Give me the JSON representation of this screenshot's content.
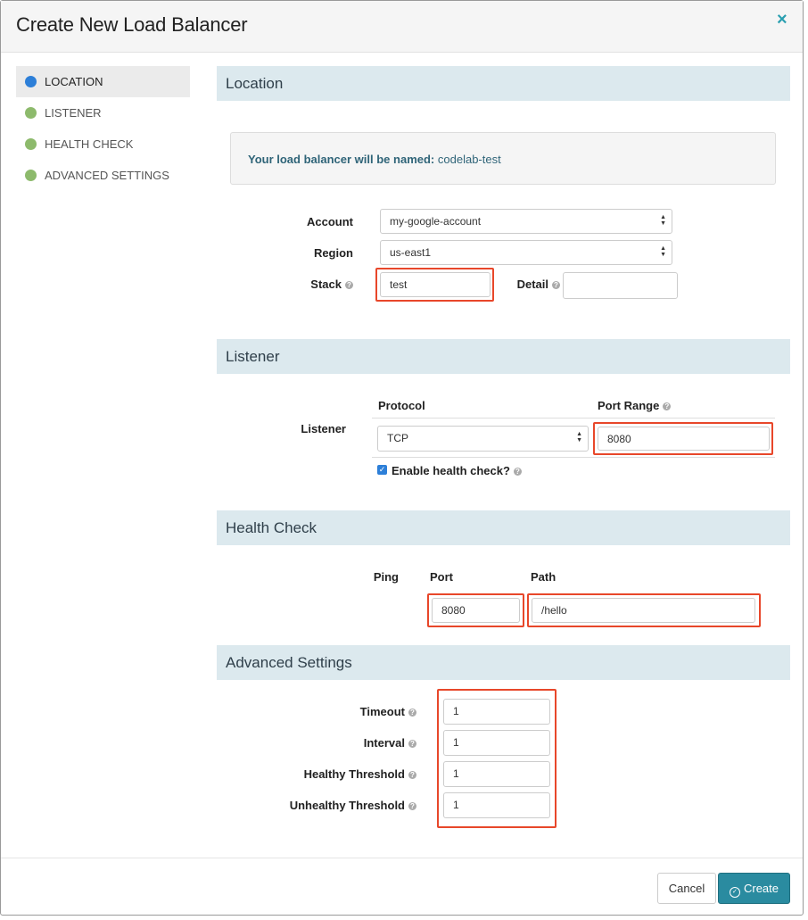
{
  "modal": {
    "title": "Create New Load Balancer",
    "close_icon": "×"
  },
  "nav": {
    "items": [
      {
        "label": "LOCATION",
        "color": "#2d7fd8",
        "active": true
      },
      {
        "label": "LISTENER",
        "color": "#8dba6c",
        "active": false
      },
      {
        "label": "HEALTH CHECK",
        "color": "#8dba6c",
        "active": false
      },
      {
        "label": "ADVANCED SETTINGS",
        "color": "#8dba6c",
        "active": false
      }
    ]
  },
  "location": {
    "title": "Location",
    "name_prefix": "Your load balancer will be named:",
    "name_value": "codelab-test",
    "account_label": "Account",
    "account_value": "my-google-account",
    "region_label": "Region",
    "region_value": "us-east1",
    "stack_label": "Stack",
    "stack_value": "test",
    "detail_label": "Detail",
    "detail_value": ""
  },
  "listener": {
    "title": "Listener",
    "row_label": "Listener",
    "protocol_header": "Protocol",
    "port_range_header": "Port Range",
    "protocol_value": "TCP",
    "port_range_value": "8080",
    "health_check_label": "Enable health check?",
    "health_check_checked": true
  },
  "health_check": {
    "title": "Health Check",
    "ping_label": "Ping",
    "port_header": "Port",
    "path_header": "Path",
    "port_value": "8080",
    "path_value": "/hello"
  },
  "advanced": {
    "title": "Advanced Settings",
    "timeout_label": "Timeout",
    "timeout_value": "1",
    "interval_label": "Interval",
    "interval_value": "1",
    "healthy_label": "Healthy Threshold",
    "healthy_value": "1",
    "unhealthy_label": "Unhealthy Threshold",
    "unhealthy_value": "1"
  },
  "footer": {
    "cancel_label": "Cancel",
    "create_label": "Create",
    "create_icon": "check-circle-icon"
  },
  "colors": {
    "accent": "#2a8ba0",
    "highlight": "#e8472a",
    "section_bg": "#dce9ee"
  }
}
